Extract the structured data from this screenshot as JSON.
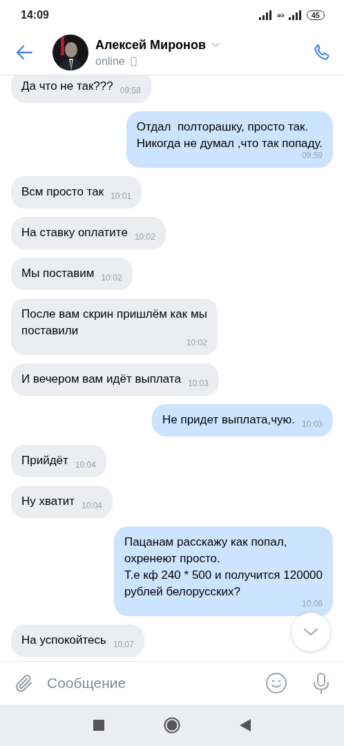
{
  "status_bar": {
    "time": "14:09",
    "network": "4G",
    "battery": "45"
  },
  "header": {
    "name": "Алексей Миронов",
    "status": "online"
  },
  "messages": [
    {
      "kind": "incoming",
      "text": "Да что не так???",
      "time": "09:58"
    },
    {
      "kind": "outgoing",
      "text": "Отдал  полторашку, просто так.\nНикогда не думал ,что так попаду.",
      "time": "09:59"
    },
    {
      "kind": "incoming",
      "text": "Всм просто так",
      "time": "10:01"
    },
    {
      "kind": "incoming",
      "text": "На ставку оплатите",
      "time": "10:02"
    },
    {
      "kind": "incoming",
      "text": "Мы поставим",
      "time": "10:02"
    },
    {
      "kind": "incoming",
      "text": "После вам скрин пришлём как мы\nпоставили",
      "time": "10:02"
    },
    {
      "kind": "incoming",
      "text": "И вечером вам идёт выплата",
      "time": "10:03"
    },
    {
      "kind": "outgoing",
      "text": "Не придет выплата,чую.",
      "time": "10:03"
    },
    {
      "kind": "incoming",
      "text": "Прийдёт",
      "time": "10:04"
    },
    {
      "kind": "incoming",
      "text": "Ну хватит",
      "time": "10:04"
    },
    {
      "kind": "outgoing",
      "text": "Пацанам расскажу как попал,\nохренеют просто.\nТ.е кф 240 * 500 и получится 120000\nрублей белорусских?",
      "time": "10:06"
    },
    {
      "kind": "incoming",
      "text": "На успокойтесь",
      "time": "10:07"
    }
  ],
  "composer": {
    "placeholder": "Сообщение"
  }
}
